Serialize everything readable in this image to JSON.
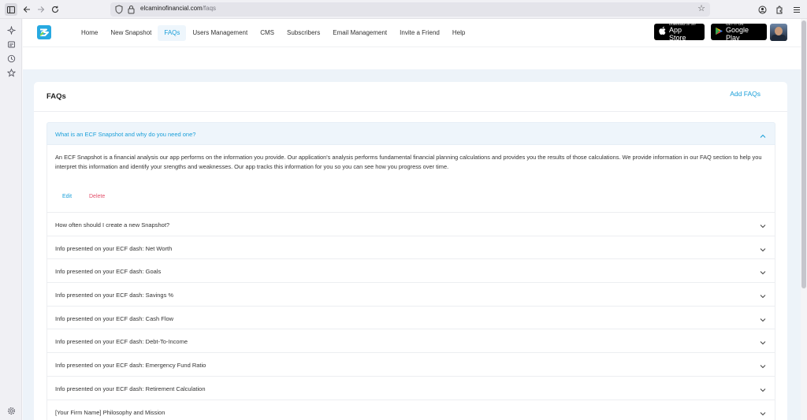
{
  "browser": {
    "url_domain": "elcaminofinancial.com",
    "url_path": "/faqs"
  },
  "nav": {
    "items": [
      {
        "label": "Home",
        "active": false
      },
      {
        "label": "New Snapshot",
        "active": false
      },
      {
        "label": "FAQs",
        "active": true
      },
      {
        "label": "Users Management",
        "active": false
      },
      {
        "label": "CMS",
        "active": false
      },
      {
        "label": "Subscribers",
        "active": false
      },
      {
        "label": "Email Management",
        "active": false
      },
      {
        "label": "Invite a Friend",
        "active": false
      },
      {
        "label": "Help",
        "active": false
      }
    ],
    "appstore_small": "Download on the",
    "appstore_big": "App Store",
    "playstore_small": "GET IT ON",
    "playstore_big": "Google Play"
  },
  "page": {
    "title": "FAQs",
    "add_button": "Add FAQs"
  },
  "faq_open": {
    "question": "What is an ECF Snapshot and why do you need one?",
    "answer": "An ECF Snapshot is a financial analysis our app performs on the information you provide. Our application's analysis performs fundamental financial planning calculations and provides you the results of those calculations. We provide information in our FAQ section to help you interpret this information and identify your srengths and weaknesses. Our app tracks this information for you so you can see how you progress over time.",
    "edit_label": "Edit",
    "delete_label": "Delete"
  },
  "faqs": [
    "How often should I create a new Snapshot?",
    "Info presented on your ECF dash: Net Worth",
    "Info presented on your ECF dash: Goals",
    "Info presented on your ECF dash: Savings %",
    "Info presented on your ECF dash: Cash Flow",
    "Info presented on your ECF dash: Debt-To-Income",
    "Info presented on your ECF dash: Emergency Fund Ratio",
    "Info presented on your ECF dash: Retirement Calculation",
    "[Your Firm Name] Philosophy and Mission"
  ],
  "colors": {
    "accent": "#1a9fd9",
    "delete": "#e34f6a",
    "app_bg": "#edf3f9"
  }
}
